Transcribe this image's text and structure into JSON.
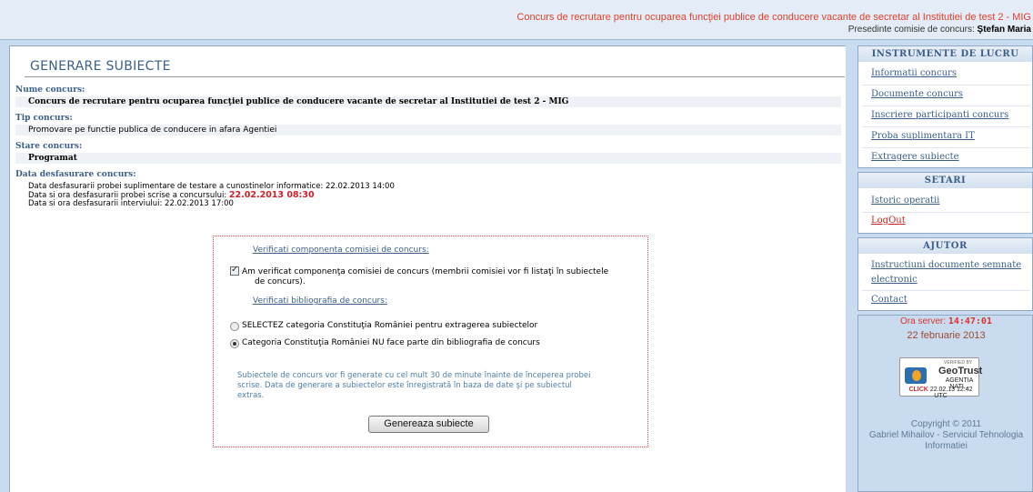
{
  "header": {
    "contest_title": "Concurs de recrutare pentru ocuparea funcţiei publice de conducere vacante de secretar al Institutiei de test 2 - MIG",
    "president_label": "Presedinte comisie de concurs:",
    "president_name": "Ştefan Maria"
  },
  "page": {
    "title": "GENERARE SUBIECTE",
    "fields": {
      "name_label": "Nume concurs:",
      "name_value": "Concurs de recrutare pentru ocuparea funcţiei publice de conducere vacante de secretar al Institutiei de test 2 - MIG",
      "type_label": "Tip concurs:",
      "type_value": "Promovare pe functie publica de conducere in afara Agentiei",
      "status_label": "Stare concurs:",
      "status_value": "Programat",
      "date_label": "Data desfasurare concurs:",
      "date_line1": "Data desfasurarii probei suplimentare de testare a cunostinelor informatice: 22.02.2013 14:00",
      "date_line2_prefix": "Data si ora desfasurarii probei scrise a concursului:",
      "date_line2_value": "22.02.2013 08:30",
      "date_line3": "Data si ora desfasurarii interviului: 22.02.2013 17:00"
    }
  },
  "form": {
    "verify_committee_link": "Verificati componenta comisiei de concurs:",
    "committee_checkbox_label_1": "Am verificat componenţa comisiei de concurs (membrii comisiei vor fi listaţi în subiectele",
    "committee_checkbox_label_2": "de concurs).",
    "committee_checked": true,
    "verify_bibliography_link": "Verificati bibliografia de concurs:",
    "radio_option_1": "SELECTEZ categoria Constituţia României pentru extragerea subiectelor",
    "radio_option_2": "Categoria Constituţia României NU face parte din bibliografia de concurs",
    "selected_radio": 2,
    "info_line_1": "Subiectele de concurs vor fi generate cu cel mult 30 de minute înainte de începerea probei",
    "info_line_2": "scrise. Data de generare a subiectelor este înregistrată în baza de date şi pe subiectul",
    "info_line_3": "extras.",
    "generate_button": "Genereaza subiecte"
  },
  "sidebar": {
    "tools_title": "INSTRUMENTE DE LUCRU",
    "tools": [
      "Informatii concurs",
      "Documente concurs",
      "Inscriere participanti concurs",
      "Proba suplimentara IT",
      "Extragere subiecte"
    ],
    "settings_title": "SETARI",
    "settings": [
      "Istoric operatii",
      "LogOut"
    ],
    "help_title": "AJUTOR",
    "help_1a": "Instructiuni documente semnate",
    "help_1b": "electronic",
    "help_2": "Contact",
    "server_time_label": "Ora server:",
    "server_time": "14:47:01",
    "server_date": "22 februarie 2013",
    "badge_verified": "VERIFIED BY",
    "badge_brand": "GeoTrust",
    "badge_agency": "AGENTIA NATI...",
    "badge_click": "CLICK",
    "badge_timestamp": "22.02.13 12:42 UTC",
    "copyright_1": "Copyright © 2011",
    "copyright_2": "Gabriel Mihailov - Serviciul Tehnologia",
    "copyright_3": "Informatiei"
  }
}
